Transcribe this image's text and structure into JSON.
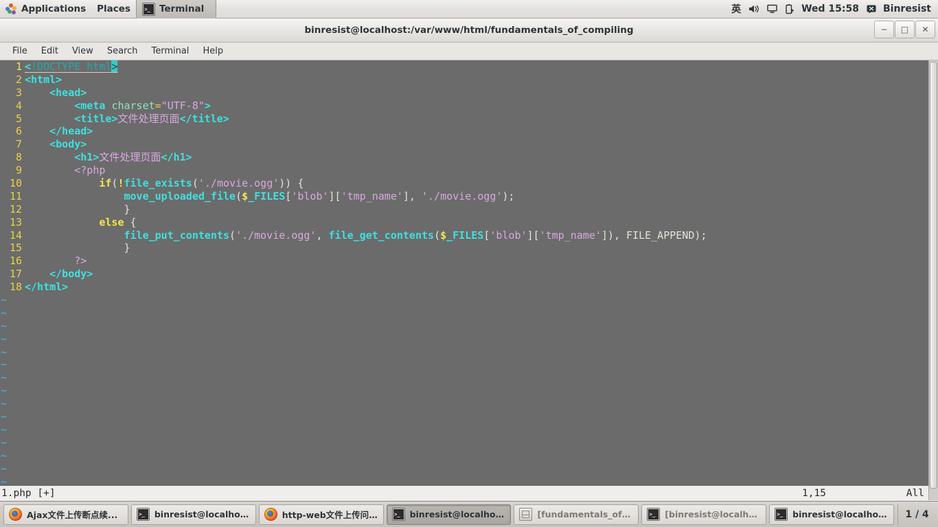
{
  "top_panel": {
    "applications_label": "Applications",
    "places_label": "Places",
    "window_button_label": "Terminal",
    "input_method": "英",
    "volume_icon": "speaker-icon",
    "display_icon": "monitor-icon",
    "battery_icon": "battery-icon",
    "clock": "Wed 15:58",
    "user_name": "Binresist"
  },
  "window": {
    "title": "binresist@localhost:/var/www/html/fundamentals_of_compiling",
    "minimize": "−",
    "maximize": "□",
    "close": "✕"
  },
  "menu": {
    "items": [
      "File",
      "Edit",
      "View",
      "Search",
      "Terminal",
      "Help"
    ]
  },
  "editor": {
    "first_line": 1,
    "last_line": 18,
    "cursor_line": 1,
    "tilde_count": 15,
    "lines": [
      {
        "n": "1",
        "indent": 0
      },
      {
        "n": "2",
        "indent": 0
      },
      {
        "n": "3",
        "indent": 1
      },
      {
        "n": "4",
        "indent": 2
      },
      {
        "n": "5",
        "indent": 2
      },
      {
        "n": "6",
        "indent": 1
      },
      {
        "n": "7",
        "indent": 1
      },
      {
        "n": "8",
        "indent": 2
      },
      {
        "n": "9",
        "indent": 2
      },
      {
        "n": "10",
        "indent": 3
      },
      {
        "n": "11",
        "indent": 4
      },
      {
        "n": "12",
        "indent": 4
      },
      {
        "n": "13",
        "indent": 3
      },
      {
        "n": "14",
        "indent": 4
      },
      {
        "n": "15",
        "indent": 4
      },
      {
        "n": "16",
        "indent": 2
      },
      {
        "n": "17",
        "indent": 1
      },
      {
        "n": "18",
        "indent": 0
      }
    ],
    "text": {
      "l1_doctype_open": "<",
      "l1_doctype_body": "!DOCTYPE html",
      "l1_doctype_close": ">",
      "l2": "<html>",
      "l3": "<head>",
      "l4_tag": "<meta",
      "l4_attr": "charset",
      "l4_eq": "=",
      "l4_val": "\"UTF-8\"",
      "l4_gt": ">",
      "l5_open": "<title>",
      "l5_text": "文件处理页面",
      "l5_close": "</title>",
      "l6": "</head>",
      "l7": "<body>",
      "l8_open": "<h1>",
      "l8_text": "文件处理页面",
      "l8_close": "</h1>",
      "l9": "<?php",
      "l10_kw": "if",
      "l10_p1": "(",
      "l10_not": "!",
      "l10_fn": "file_exists",
      "l10_p2": "(",
      "l10_str": "'./movie.ogg'",
      "l10_p3": "))",
      "l10_brace": " {",
      "l11_fn": "move_uploaded_file",
      "l11_p1": "(",
      "l11_dollar": "$",
      "l11_var": "_FILES",
      "l11_b1": "[",
      "l11_s1": "'blob'",
      "l11_b2": "][",
      "l11_s2": "'tmp_name'",
      "l11_b3": "], ",
      "l11_s3": "'./movie.ogg'",
      "l11_end": ");",
      "l12": "}",
      "l13_kw": "else",
      "l13_brace": " {",
      "l14_fn1": "file_put_contents",
      "l14_p1": "(",
      "l14_s1": "'./movie.ogg'",
      "l14_c1": ", ",
      "l14_fn2": "file_get_contents",
      "l14_p2": "(",
      "l14_dollar": "$",
      "l14_var": "_FILES",
      "l14_b1": "[",
      "l14_s2": "'blob'",
      "l14_b2": "][",
      "l14_s3": "'tmp_name'",
      "l14_b3": "])",
      "l14_c2": ", ",
      "l14_const": "FILE_APPEND",
      "l14_end": ");",
      "l15": "}",
      "l16": "?>",
      "l17": "</body>",
      "l18": "</html>",
      "tilde": "~"
    }
  },
  "vim_status": {
    "file": "1.php [+]",
    "position": "1,15",
    "scroll": "All"
  },
  "taskbar": {
    "items": [
      {
        "icon": "firefox-icon",
        "label": "Ajax文件上传断点续...",
        "state": "normal"
      },
      {
        "icon": "terminal-icon",
        "label": "binresist@localhost:...",
        "state": "normal"
      },
      {
        "icon": "firefox-icon",
        "label": "http-web文件上传问...",
        "state": "normal"
      },
      {
        "icon": "terminal-icon",
        "label": "binresist@localhost:...",
        "state": "active"
      },
      {
        "icon": "files-icon",
        "label": "[fundamentals_of_c...",
        "state": "minimized"
      },
      {
        "icon": "terminal-icon",
        "label": "[binresist@localhost...",
        "state": "minimized"
      },
      {
        "icon": "terminal-icon",
        "label": "binresist@localhost:...",
        "state": "normal"
      }
    ],
    "workspace": "1 / 4"
  },
  "colors": {
    "terminal_bg": "#6b6b6b",
    "line_number": "#e8d24a",
    "tag": "#3fe0e0",
    "string": "#d9a8e0",
    "keyword": "#f2e750",
    "cursor": "#35c9c9",
    "panel_bg": "#e4e2e0"
  }
}
